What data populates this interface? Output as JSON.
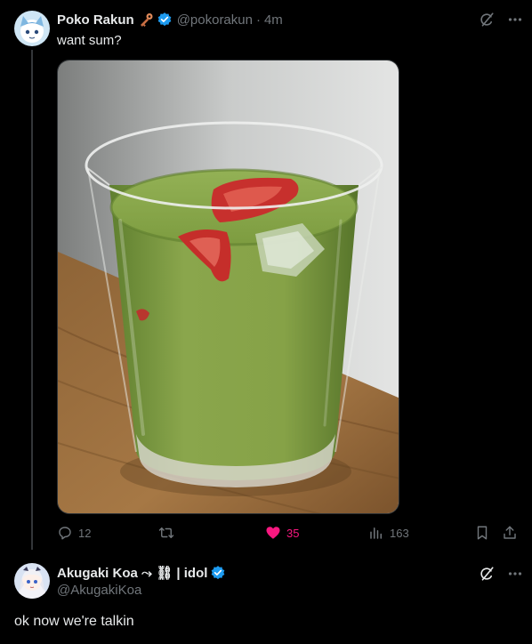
{
  "post": {
    "author_name": "Poko Rakun",
    "handle": "@pokorakun",
    "separator": "·",
    "time": "4m",
    "text": "want sum?",
    "media_icon": "photo-strawberry-matcha-latte",
    "stats": {
      "replies": "12",
      "reposts": "",
      "likes": "35",
      "views": "163"
    }
  },
  "reply": {
    "author_name": "Akugaki Koa ⤳ ⛓ | idol",
    "handle": "@AkugakiKoa",
    "text": "ok now we're talkin"
  },
  "colors": {
    "background": "#000000",
    "text_primary": "#e7e9ea",
    "text_secondary": "#71767b",
    "verified": "#1d9bf0",
    "like": "#f91880",
    "thread_line": "#333639"
  },
  "icons": [
    "verified-badge-icon",
    "key-icon",
    "grok-icon",
    "more-icon",
    "reply-icon",
    "repost-icon",
    "heart-icon",
    "views-icon",
    "bookmark-icon",
    "share-icon"
  ]
}
